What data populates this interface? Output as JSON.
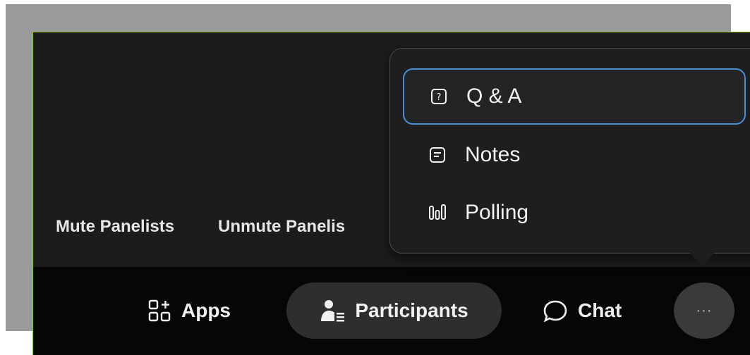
{
  "panel_actions": {
    "mute_label": "Mute Panelists",
    "unmute_label": "Unmute Panelis"
  },
  "toolbar": {
    "apps_label": "Apps",
    "participants_label": "Participants",
    "chat_label": "Chat",
    "more_label": "···"
  },
  "menu": {
    "items": [
      {
        "label": "Q & A",
        "icon": "question-box-icon",
        "selected": true
      },
      {
        "label": "Notes",
        "icon": "notes-icon",
        "selected": false
      },
      {
        "label": "Polling",
        "icon": "polling-icon",
        "selected": false
      }
    ]
  },
  "colors": {
    "window_border": "#8fc01a",
    "focus_ring": "#4a8fd6",
    "toolbar_bg": "#060606",
    "window_bg": "#1c1c1c"
  }
}
